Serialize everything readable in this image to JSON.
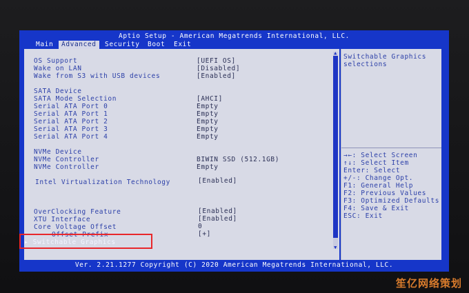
{
  "window": {
    "title": "Aptio Setup - American Megatrends International, LLC.",
    "footer": "Ver. 2.21.1277 Copyright (C) 2020 American Megatrends International, LLC."
  },
  "menu": {
    "tabs": [
      "Main",
      "Advanced",
      "Security",
      "Boot",
      "Exit"
    ],
    "active": "Advanced"
  },
  "settings": [
    {
      "label": "OS Support",
      "value": "[UEFI OS]"
    },
    {
      "label": "Wake on LAN",
      "value": "[Disabled]"
    },
    {
      "label": "Wake from S3 with USB devices",
      "value": "[Enabled]"
    },
    {
      "label": "SATA Device",
      "value": ""
    },
    {
      "label": "SATA Mode Selection",
      "value": "[AHCI]"
    },
    {
      "label": "Serial ATA Port 0",
      "value": "Empty"
    },
    {
      "label": "Serial ATA Port 1",
      "value": "Empty"
    },
    {
      "label": "Serial ATA Port 2",
      "value": "Empty"
    },
    {
      "label": "Serial ATA Port 3",
      "value": "Empty"
    },
    {
      "label": "Serial ATA Port 4",
      "value": "Empty"
    },
    {
      "label": "NVMe Device",
      "value": ""
    },
    {
      "label": "NVMe Controller",
      "value": "BIWIN SSD (512.1GB)"
    },
    {
      "label": "NVMe Controller",
      "value": "Empty"
    },
    {
      "label": "Intel Virtualization Technology",
      "value": "[Enabled]"
    },
    {
      "label": "OverClocking Feature",
      "value": "[Enabled]"
    },
    {
      "label": "XTU Interface",
      "value": "[Enabled]"
    },
    {
      "label": "Core Voltage Offset",
      "value": "0"
    },
    {
      "label": "Offset Prefix",
      "value": "[+]"
    },
    {
      "label": "▸ Switchable Graphics",
      "value": ""
    }
  ],
  "help": {
    "description": [
      "Switchable Graphics",
      "selections"
    ],
    "keys": [
      "→←: Select Screen",
      "↑↓: Select Item",
      "Enter: Select",
      "+/-: Change Opt.",
      "F1: General Help",
      "F2: Previous Values",
      "F3: Optimized Defaults",
      "F4: Save & Exit",
      "ESC: Exit"
    ]
  },
  "scrollbar": {
    "up_glyph": "▲",
    "down_glyph": "▼"
  },
  "colors": {
    "background": "#1636c9",
    "panel": "#d8dae6",
    "text": "#2b3fa8",
    "highlight_box": "#e8262a"
  },
  "watermark": "笙亿网络策划"
}
